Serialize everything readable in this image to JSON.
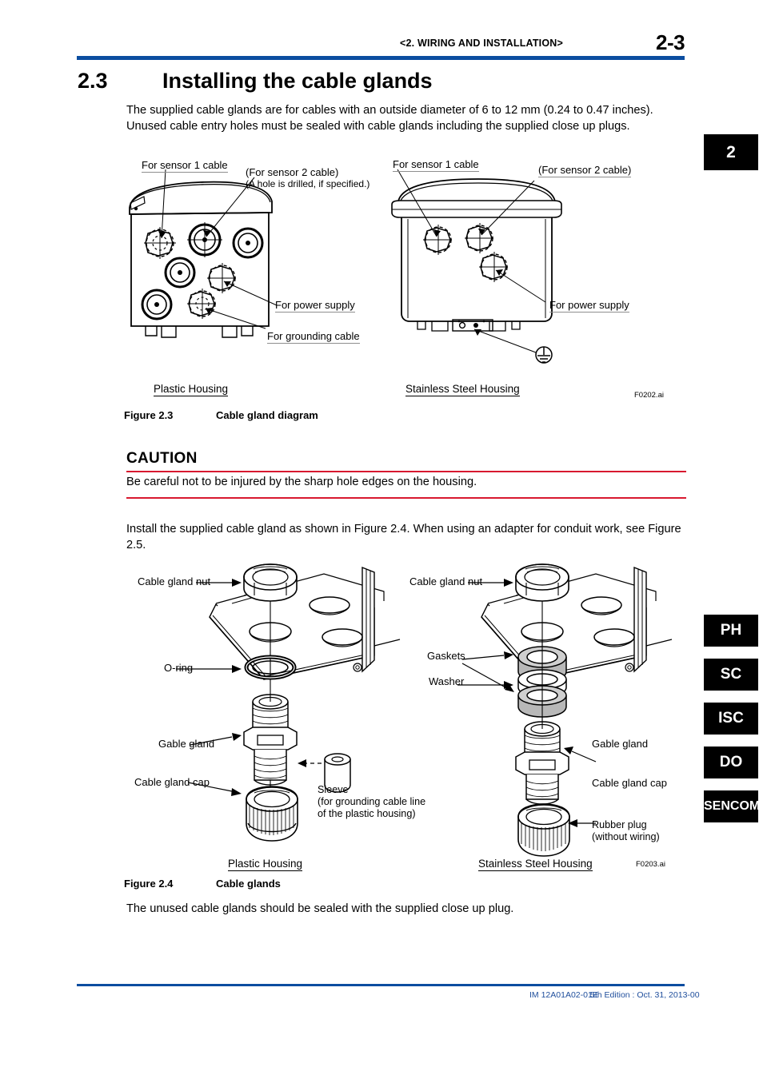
{
  "header": {
    "chapter": "<2.  WIRING AND INSTALLATION>",
    "page_number": "2-3"
  },
  "section": {
    "number": "2.3",
    "title": "Installing the cable glands",
    "intro": "The supplied cable glands are for cables with an outside diameter of 6 to 12 mm (0.24 to 0.47 inches). Unused cable entry holes must be sealed with cable glands including the supplied close up plugs."
  },
  "figure_2_3": {
    "caption_number": "Figure 2.3",
    "caption_title": "Cable gland diagram",
    "ai_tag": "F0202.ai",
    "plastic": {
      "housing_label": "Plastic Housing",
      "callout_sensor1": "For sensor 1 cable",
      "callout_sensor2": "(For sensor 2 cable)",
      "callout_sensor2_note": "(A hole is drilled, if specified.)",
      "callout_power": "For power supply",
      "callout_ground": "For grounding cable"
    },
    "stainless": {
      "housing_label": "Stainless Steel Housing",
      "callout_sensor1": "For sensor 1 cable",
      "callout_sensor2": "(For sensor 2 cable)",
      "callout_power": "For power supply"
    }
  },
  "caution": {
    "heading": "CAUTION",
    "text": "Be careful not to be injured by the sharp hole edges on the housing.",
    "rule_color": "#d8192f"
  },
  "install_note": "Install the supplied cable gland as shown in Figure 2.4. When using an adapter for conduit work, see Figure 2.5.",
  "figure_2_4": {
    "caption_number": "Figure 2.4",
    "caption_title": "Cable glands",
    "ai_tag": "F0203.ai",
    "plastic": {
      "housing_label": "Plastic Housing",
      "nut": "Cable gland nut",
      "oring": "O-ring",
      "gland": "Gable gland",
      "cap": "Cable gland cap",
      "sleeve_l1": "Sleeve",
      "sleeve_l2": "(for grounding cable line",
      "sleeve_l3": " of the plastic housing)"
    },
    "stainless": {
      "housing_label": "Stainless Steel Housing",
      "nut": "Cable gland nut",
      "gaskets": "Gaskets",
      "washer": "Washer",
      "gland": "Gable gland",
      "cap": "Cable gland cap",
      "plug_l1": "Rubber plug",
      "plug_l2": "(without wiring)"
    }
  },
  "closing": "The unused cable glands should be sealed with the supplied close up plug.",
  "side_tabs": [
    {
      "label": "2"
    },
    {
      "label": "PH"
    },
    {
      "label": "SC"
    },
    {
      "label": "ISC"
    },
    {
      "label": "DO"
    },
    {
      "label": "SENCOM"
    }
  ],
  "footer": {
    "doc_number": "IM 12A01A02-01E",
    "edition": "5th Edition : Oct. 31, 2013-00",
    "accent_color": "#0b4da0"
  }
}
